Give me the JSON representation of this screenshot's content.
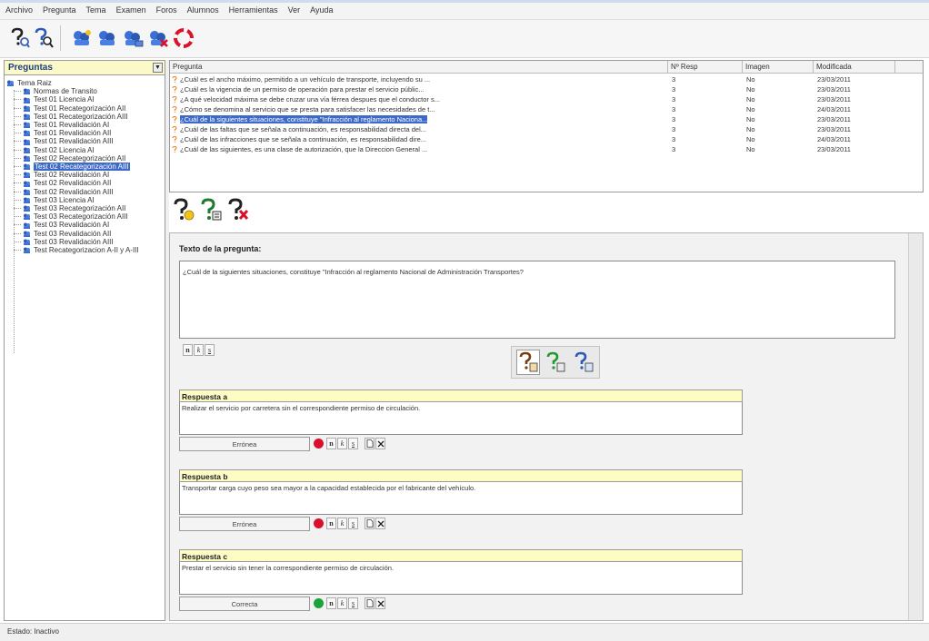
{
  "menu": [
    "Archivo",
    "Pregunta",
    "Tema",
    "Examen",
    "Foros",
    "Alumnos",
    "Herramientas",
    "Ver",
    "Ayuda"
  ],
  "left_panel": {
    "title": "Preguntas",
    "root": "Tema Raiz",
    "items": [
      "Normas de Transito",
      "Test 01 Licencia AI",
      "Test 01 Recategorización AII",
      "Test 01 Recategorización AIII",
      "Test 01 Revalidación AI",
      "Test 01 Revalidación AII",
      "Test 01 Revalidación AIII",
      "Test 02 Licencia AI",
      "Test 02 Recategorización AII",
      "Test 02 Recategorización AIII",
      "Test 02 Revalidación AI",
      "Test 02 Revalidación AII",
      "Test 02 Revalidación AIII",
      "Test 03 Licencia AI",
      "Test 03 Recategorización AII",
      "Test 03 Recategorización AIII",
      "Test 03 Revalidación AI",
      "Test 03 Revalidación AII",
      "Test 03 Revalidación AIII",
      "Test Recategorizacion A-II y A-III"
    ],
    "selected_index": 9
  },
  "question_list": {
    "headers": [
      "Pregunta",
      "Nº Resp",
      "Imagen",
      "Modificada"
    ],
    "rows": [
      {
        "q": "¿Cuál es el ancho máximo, permitido a un vehículo de transporte, incluyendo su ...",
        "n": "3",
        "img": "No",
        "date": "23/03/2011"
      },
      {
        "q": "¿Cuál es la vigencia de un permiso de operación para prestar el servicio públic...",
        "n": "3",
        "img": "No",
        "date": "23/03/2011"
      },
      {
        "q": "¿A qué velocidad máxima se debe cruzar una vía férrea despues que el conductor s...",
        "n": "3",
        "img": "No",
        "date": "23/03/2011"
      },
      {
        "q": "¿Cómo se denomina al servicio que se presta para satisfacer las necesidades de t...",
        "n": "3",
        "img": "No",
        "date": "24/03/2011"
      },
      {
        "q": "¿Cuál de la siguientes situaciones, constituye \"Infracción al reglamento Naciona...",
        "n": "3",
        "img": "No",
        "date": "23/03/2011"
      },
      {
        "q": "¿Cuál de las faltas que se señala a continuación, es responsabilidad directa del...",
        "n": "3",
        "img": "No",
        "date": "23/03/2011"
      },
      {
        "q": "¿Cuál de las infracciones que se  señala a continuación, es responsabilidad dire...",
        "n": "3",
        "img": "No",
        "date": "24/03/2011"
      },
      {
        "q": "¿Cuál de las siguientes, es una clase de autorización, que la Direccion General ...",
        "n": "3",
        "img": "No",
        "date": "23/03/2011"
      }
    ],
    "selected_index": 4
  },
  "editor": {
    "title": "Texto de la pregunta:",
    "question_text": "¿Cuál de la siguientes situaciones, constituye \"Infracción al reglamento Nacional de Administración Transportes?",
    "answers": [
      {
        "label": "Respuesta a",
        "text": "Realizar el servicio por carretera sin el correspondiente permiso de circulación.",
        "status": "Errónea",
        "dot_color": "#d8102c"
      },
      {
        "label": "Respuesta b",
        "text": "Transportar carga cuyo peso sea mayor a la capacidad establecida por el fabricante del vehículo.",
        "status": "Errónea",
        "dot_color": "#d8102c"
      },
      {
        "label": "Respuesta c",
        "text": "Prestar el servicio sin tener la correspondiente permiso de circulación.",
        "status": "Correcta",
        "dot_color": "#1aa33a"
      }
    ]
  },
  "format_buttons": {
    "bold": "n",
    "italic": "k",
    "underline": "s"
  },
  "status_bar": "Estado: Inactivo",
  "icons": [
    "search-question-icon",
    "search-icon",
    "new-user-group-icon",
    "user-group-icon",
    "user-group-edit-icon",
    "user-group-delete-icon",
    "lifebuoy-icon",
    "add-answer-icon",
    "edit-answer-icon",
    "delete-answer-icon",
    "help-image-icon",
    "help-add-icon",
    "help-icon",
    "new-doc-icon",
    "delete-x-icon"
  ]
}
